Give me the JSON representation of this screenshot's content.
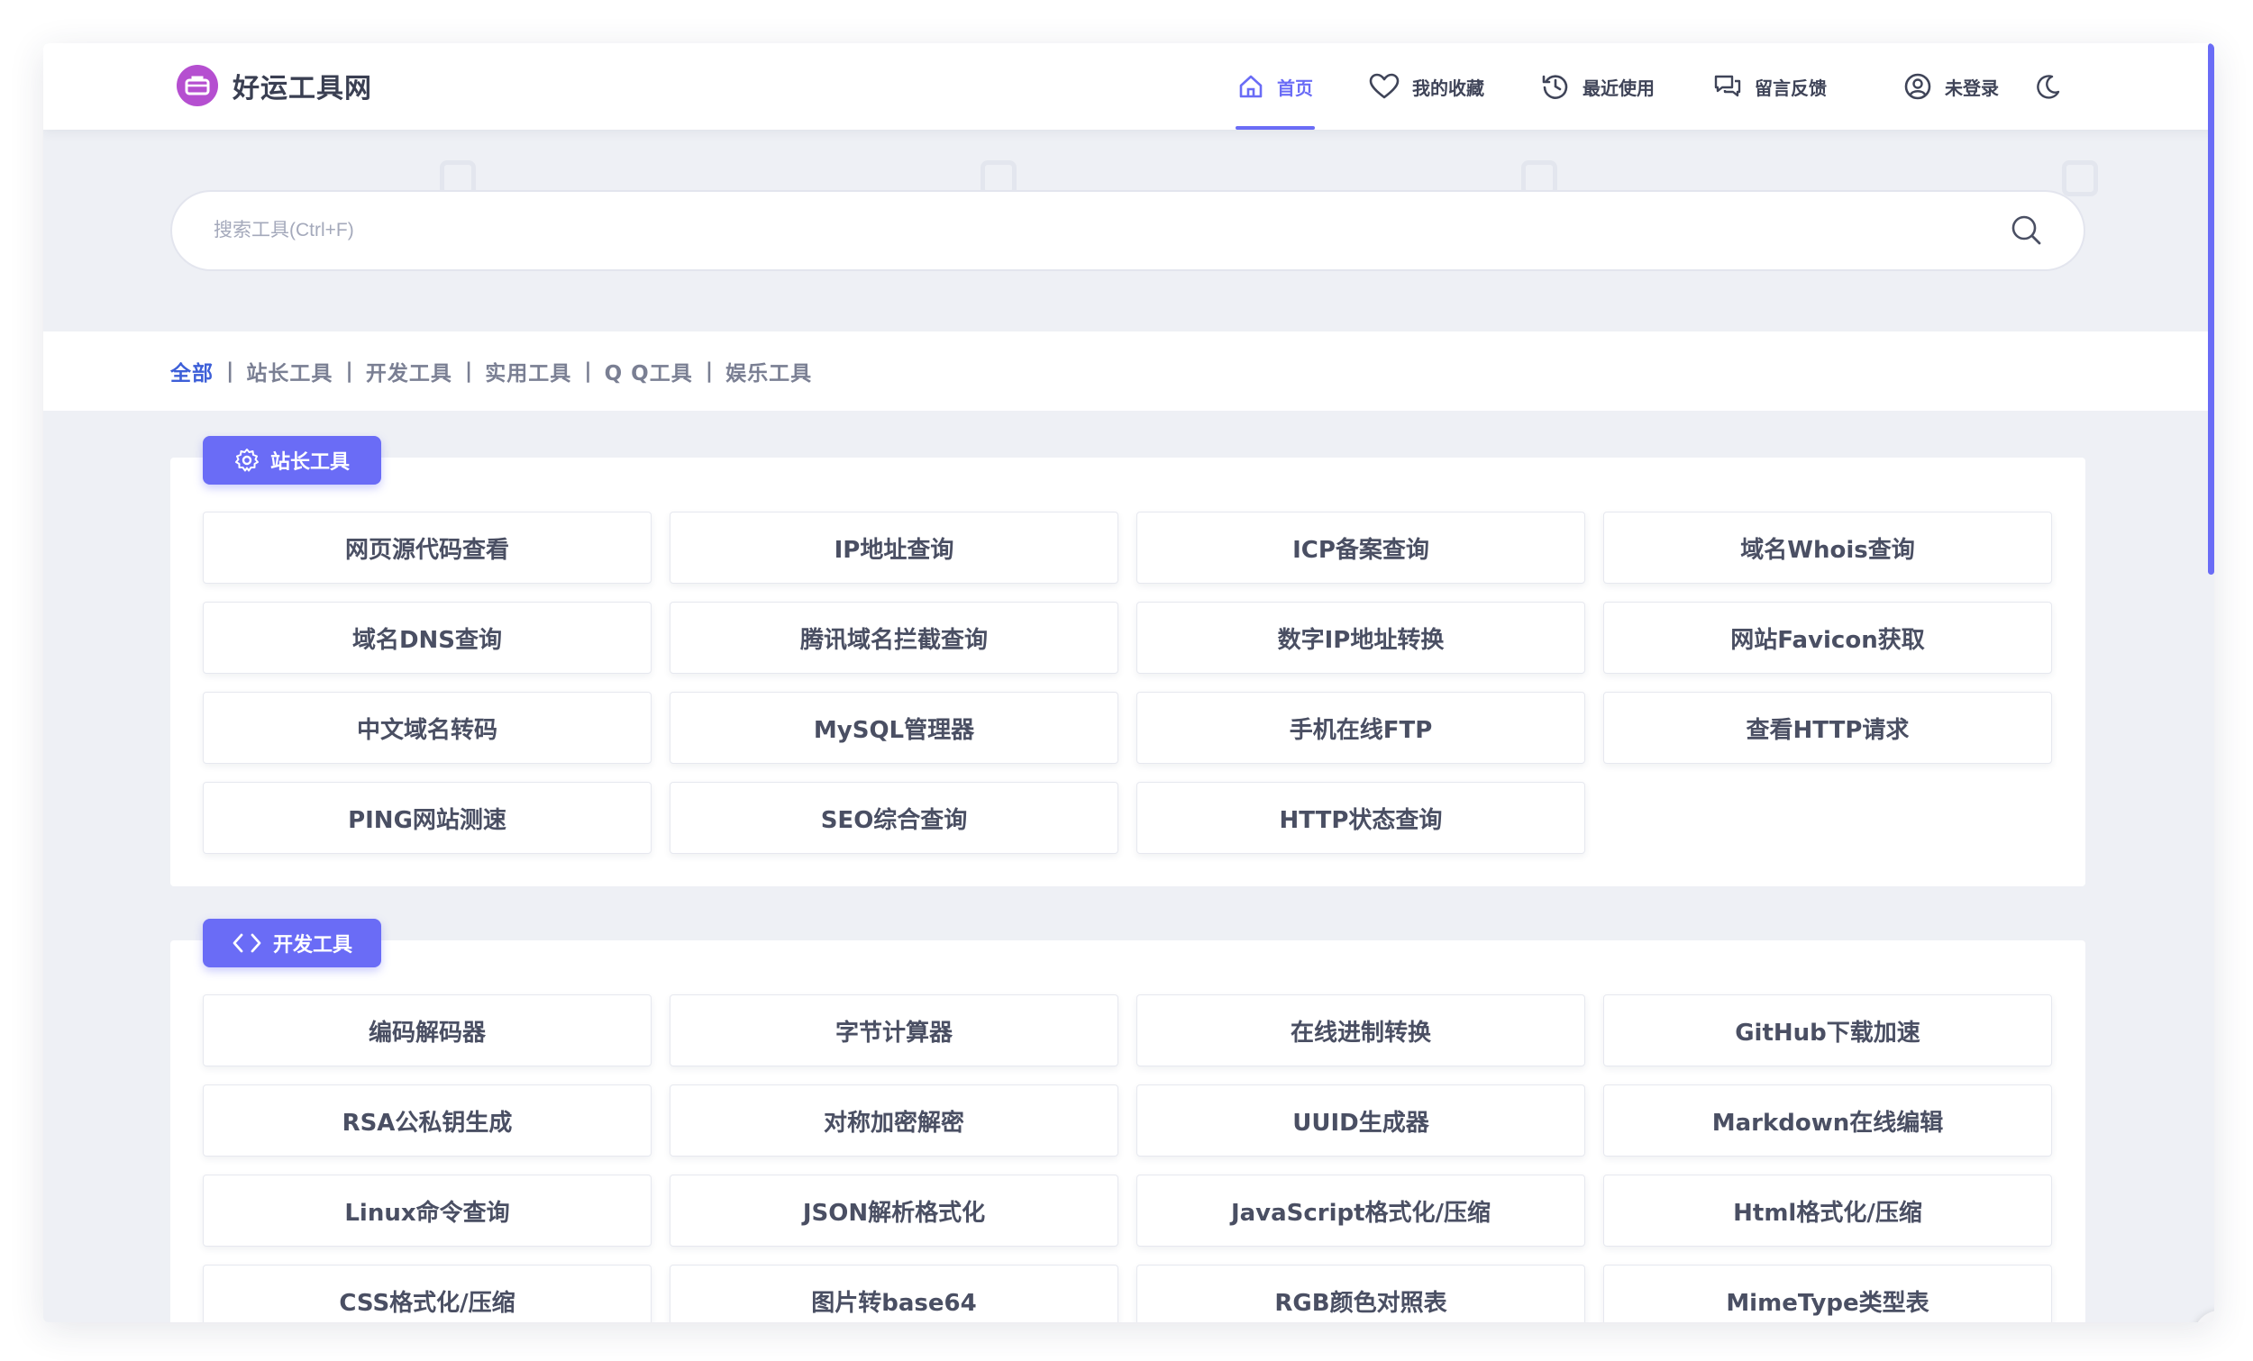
{
  "app": {
    "name": "好运工具网"
  },
  "nav": {
    "home": "首页",
    "favorites": "我的收藏",
    "recent": "最近使用",
    "feedback": "留言反馈",
    "login": "未登录"
  },
  "search": {
    "placeholder": "搜索工具(Ctrl+F)"
  },
  "categories": [
    "全部",
    "站长工具",
    "开发工具",
    "实用工具",
    "Q Q工具",
    "娱乐工具"
  ],
  "sections": [
    {
      "title": "站长工具",
      "icon": "gear-icon",
      "tools": [
        "网页源代码查看",
        "IP地址查询",
        "ICP备案查询",
        "域名Whois查询",
        "域名DNS查询",
        "腾讯域名拦截查询",
        "数字IP地址转换",
        "网站Favicon获取",
        "中文域名转码",
        "MySQL管理器",
        "手机在线FTP",
        "查看HTTP请求",
        "PING网站测速",
        "SEO综合查询",
        "HTTP状态查询"
      ]
    },
    {
      "title": "开发工具",
      "icon": "code-icon",
      "tools": [
        "编码解码器",
        "字节计算器",
        "在线进制转换",
        "GitHub下载加速",
        "RSA公私钥生成",
        "对称加密解密",
        "UUID生成器",
        "Markdown在线编辑",
        "Linux命令查询",
        "JSON解析格式化",
        "JavaScript格式化/压缩",
        "Html格式化/压缩",
        "CSS格式化/压缩",
        "图片转base64",
        "RGB颜色对照表",
        "MimeType类型表"
      ]
    }
  ],
  "colors": {
    "accent": "#6a6cf6",
    "logo": "#b54fd0",
    "category_active": "#3d5fd8"
  }
}
